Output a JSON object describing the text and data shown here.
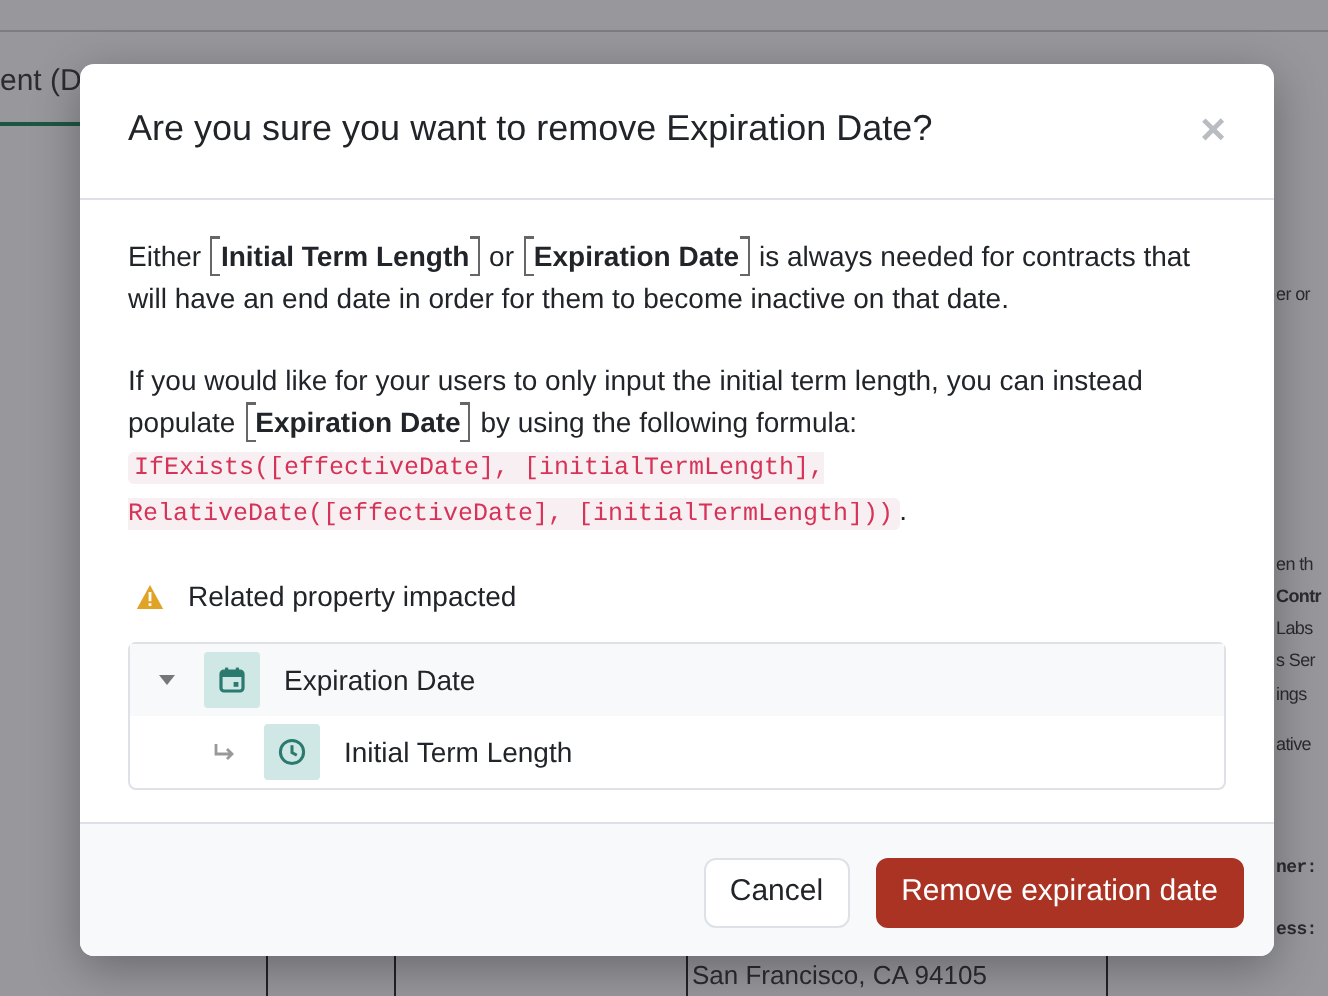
{
  "background_page": {
    "tab_label": "ent (D",
    "side_texts": [
      {
        "kind": "plain",
        "text": "er or"
      },
      {
        "kind": "plain",
        "text": "en th"
      },
      {
        "kind": "bold",
        "text": "Contr"
      },
      {
        "kind": "plain",
        "text": "Labs"
      },
      {
        "kind": "plain",
        "text": "s Ser"
      },
      {
        "kind": "plain",
        "text": "ings"
      },
      {
        "kind": "plain",
        "text": "ative"
      },
      {
        "kind": "mono",
        "text": "ner:"
      },
      {
        "kind": "mono",
        "text": "ess:"
      }
    ],
    "address": "San Francisco, CA 94105"
  },
  "dialog": {
    "title": "Are you sure you want to remove Expiration Date?",
    "close": "×",
    "paragraphs": [
      {
        "segments": [
          {
            "kind": "text",
            "text": "Either "
          },
          {
            "kind": "token",
            "text": "Initial Term Length"
          },
          {
            "kind": "text",
            "text": " or "
          },
          {
            "kind": "token",
            "text": "Expiration Date"
          },
          {
            "kind": "text",
            "text": " is always needed for contracts that will have an end date in order for them to become inactive on that date."
          }
        ]
      },
      {
        "segments": [
          {
            "kind": "text",
            "text": "If you would like for your users to only input the initial term length, you can instead populate "
          },
          {
            "kind": "token",
            "text": "Expiration Date"
          },
          {
            "kind": "text",
            "text": " by using the following formula: "
          },
          {
            "kind": "code",
            "text": "IfExists([effectiveDate], [initialTermLength], RelativeDate([effectiveDate], [initialTermLength]))"
          },
          {
            "kind": "text",
            "text": "."
          }
        ]
      }
    ],
    "warning": "Related property impacted",
    "tree": [
      {
        "label": "Expiration Date",
        "kind": "date",
        "expanded": true,
        "children": [
          {
            "label": "Initial Term Length",
            "kind": "duration"
          }
        ]
      }
    ],
    "buttons": [
      {
        "label": "Cancel",
        "kind": "secondary"
      },
      {
        "label": "Remove expiration date",
        "kind": "danger"
      }
    ]
  }
}
